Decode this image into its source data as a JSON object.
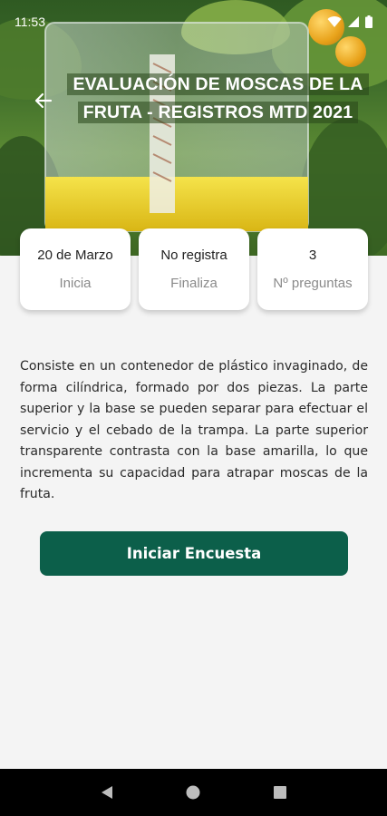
{
  "status_bar": {
    "time": "11:53"
  },
  "header": {
    "title": "EVALUACIÓN DE MOSCAS DE LA FRUTA - REGISTROS MTD 2021"
  },
  "cards": [
    {
      "value": "20 de Marzo",
      "label": "Inicia"
    },
    {
      "value": "No registra",
      "label": "Finaliza"
    },
    {
      "value": "3",
      "label": "Nº preguntas"
    }
  ],
  "description": "Consiste en un contenedor de plástico invaginado, de forma cilíndrica, formado por dos piezas. La parte superior y  la  base se pueden separar para efectuar el servicio y el cebado de la trampa. La parte superior transparente contrasta con la base amarilla, lo que incrementa su capacidad para atrapar moscas de la fruta.",
  "actions": {
    "start_label": "Iniciar Encuesta"
  },
  "colors": {
    "primary": "#0c5f4a",
    "background": "#f4f4f4",
    "nav_bar": "#000000"
  },
  "icons": {
    "back": "arrow-left-icon",
    "wifi": "wifi-icon",
    "signal": "signal-icon",
    "battery": "battery-icon",
    "nav_back": "triangle-back-icon",
    "nav_home": "circle-home-icon",
    "nav_recents": "square-recents-icon"
  }
}
